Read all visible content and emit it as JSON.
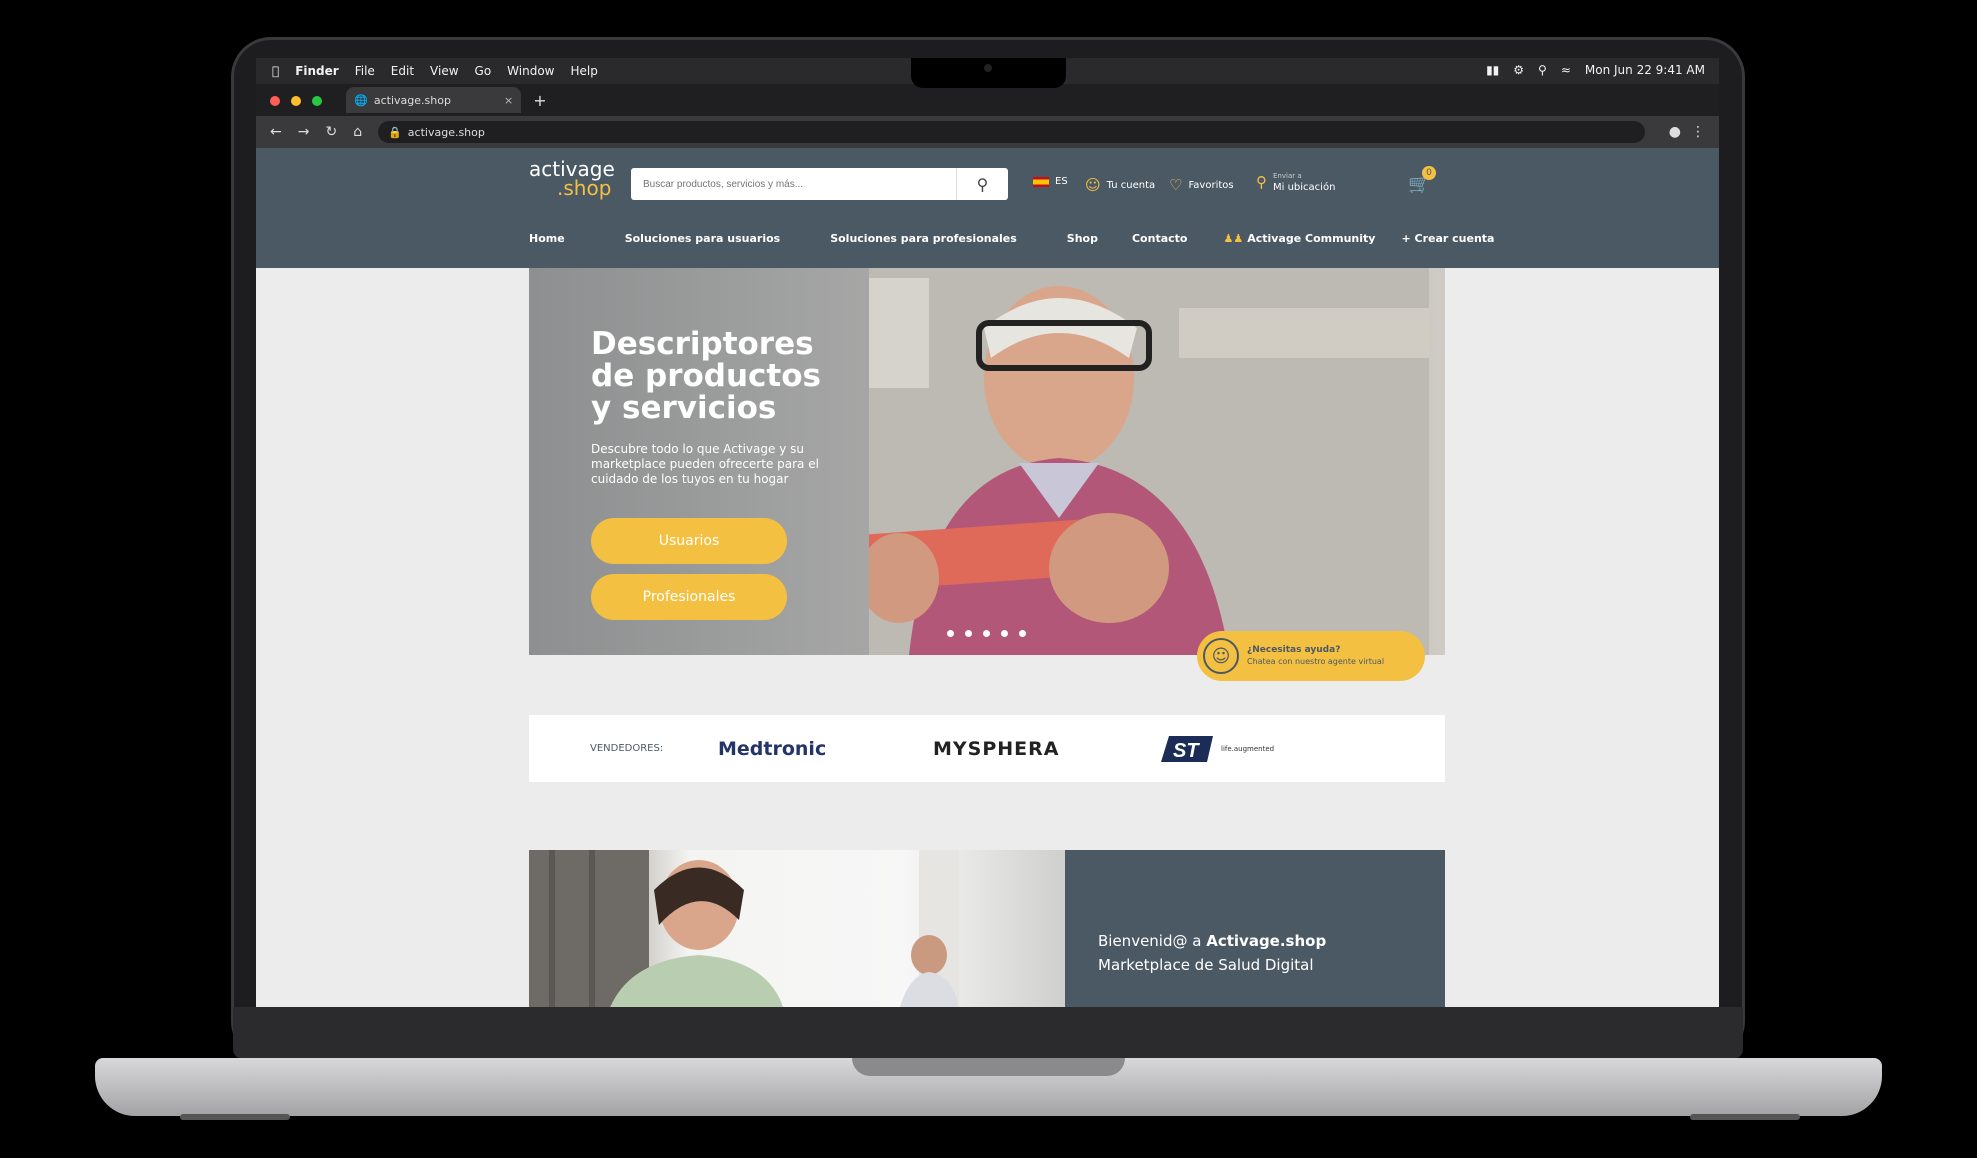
{
  "macos": {
    "menus": [
      "Finder",
      "File",
      "Edit",
      "View",
      "Go",
      "Window",
      "Help"
    ],
    "datetime": "Mon Jun 22  9:41 AM"
  },
  "browser": {
    "tab_title": "activage.shop",
    "url": "activage.shop"
  },
  "site": {
    "logo_line1": "activage",
    "logo_line2": ".shop",
    "search_placeholder": "Buscar productos, servicios y más...",
    "language": "ES",
    "account": "Tu cuenta",
    "favorites": "Favoritos",
    "location_top": "Enviar a",
    "location_bottom": "Mi ubicación",
    "cart_count": "0",
    "nav": [
      "Home",
      "Soluciones para usuarios",
      "Soluciones para profesionales",
      "Shop",
      "Contacto",
      "Activage Community",
      "+ Crear cuenta"
    ]
  },
  "hero": {
    "title_lines": [
      "Descriptores",
      "de productos",
      "y servicios"
    ],
    "subtitle": "Descubre todo lo que Activage y su marketplace pueden ofrecerte para el cuidado de los tuyos en tu hogar",
    "btn_users": "Usuarios",
    "btn_pros": "Profesionales",
    "slides": 5
  },
  "help": {
    "title": "¿Necesitas ayuda?",
    "subtitle": "Chatea con nuestro agente virtual"
  },
  "vendors": {
    "label": "VENDEDORES:",
    "items": [
      "Medtronic",
      "MYSPHERA",
      "life.augmented"
    ]
  },
  "welcome": {
    "line1_prefix": "Bienvenid@ a ",
    "line1_bold": "Activage.shop",
    "line2": "Marketplace de Salud Digital"
  },
  "colors": {
    "header": "#4b5965",
    "accent": "#f4c041"
  }
}
